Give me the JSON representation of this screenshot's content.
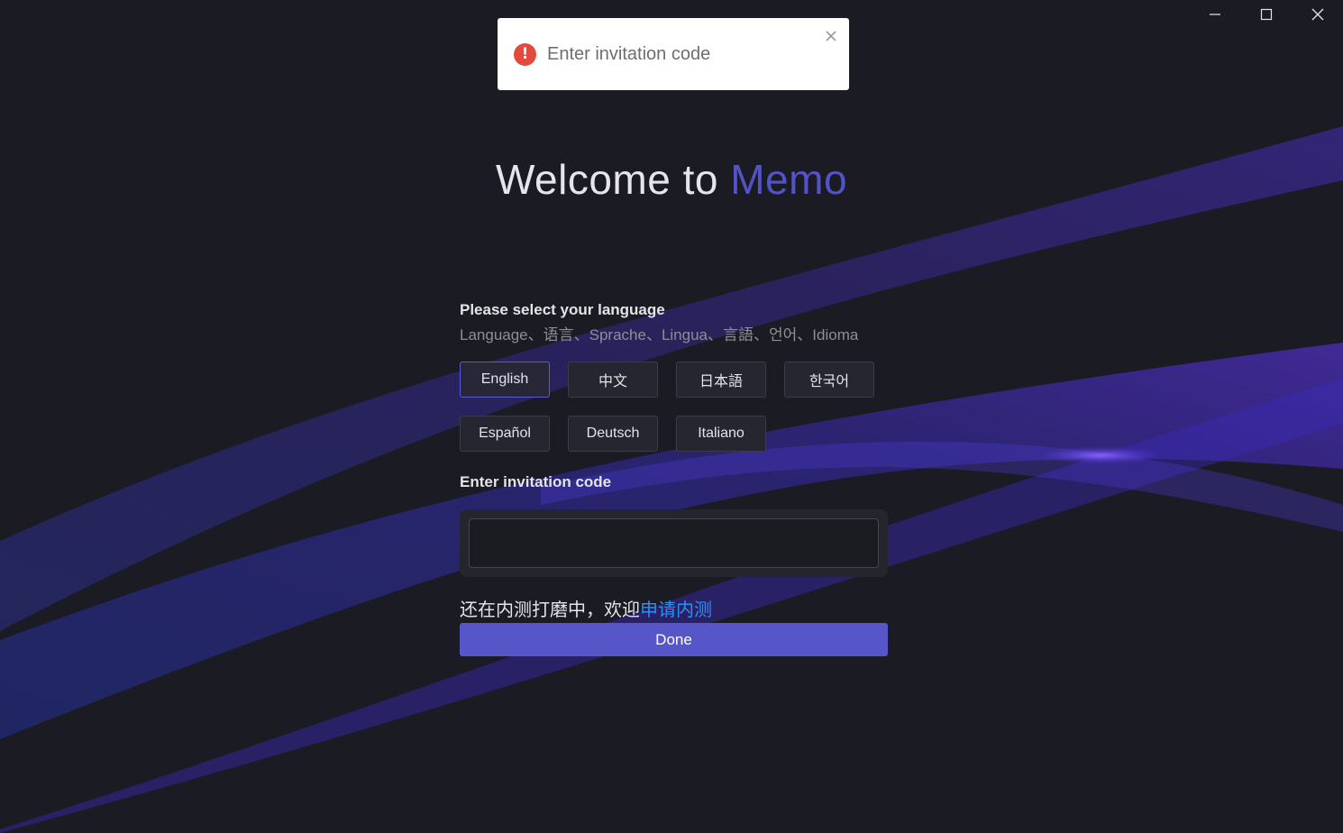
{
  "toast": {
    "message": "Enter invitation code",
    "icon": "error-icon",
    "icon_glyph": "!"
  },
  "window": {
    "controls": [
      "minimize-icon",
      "maximize-icon",
      "close-icon"
    ]
  },
  "welcome": {
    "prefix": "Welcome to ",
    "brand": "Memo",
    "brand_color": "#5353c8"
  },
  "language": {
    "title": "Please select your language",
    "subtitle": "Language、语言、Sprache、Lingua、言語、언어、Idioma",
    "selected": "English",
    "options": [
      "English",
      "中文",
      "日本語",
      "한국어",
      "Español",
      "Deutsch",
      "Italiano"
    ]
  },
  "invitation": {
    "title": "Enter invitation code",
    "value": "",
    "placeholder": ""
  },
  "beta": {
    "text": "还在内测打磨中，欢迎",
    "link": "申请内测",
    "link_color": "#2b8ff6"
  },
  "done_label": "Done",
  "colors": {
    "background": "#1b1b24",
    "accent": "#5656c9"
  }
}
